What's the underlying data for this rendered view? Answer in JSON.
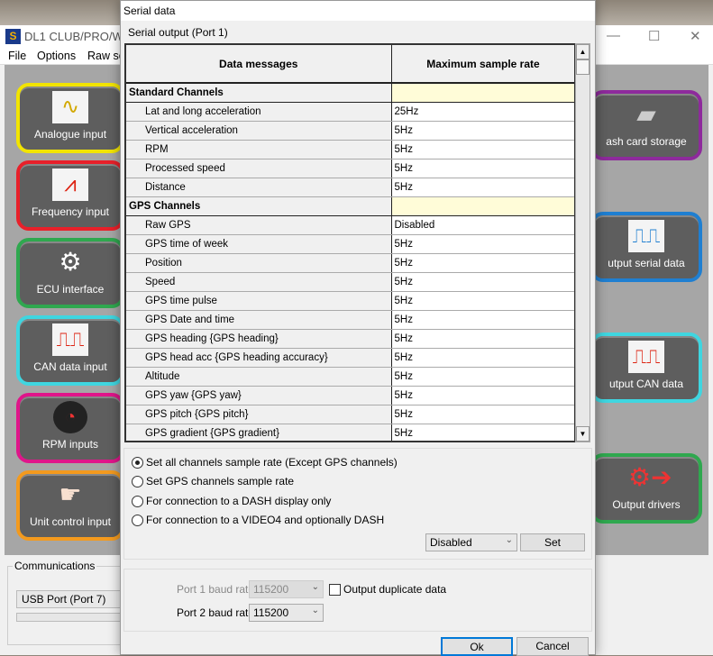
{
  "app": {
    "title": "DL1 CLUB/PRO/WP/",
    "menu": [
      "File",
      "Options",
      "Raw se"
    ],
    "left_tiles": [
      {
        "label": "Analogue input",
        "color": "#f2e400",
        "icon": "sine-wave-icon"
      },
      {
        "label": "Frequency input",
        "color": "#e8202a",
        "icon": "heartbeat-icon"
      },
      {
        "label": "ECU interface",
        "color": "#2fa84f",
        "icon": "engine-icon"
      },
      {
        "label": "CAN data input",
        "color": "#3fd6e0",
        "icon": "square-wave-icon"
      },
      {
        "label": "RPM inputs",
        "color": "#e0158a",
        "icon": "gauge-icon"
      },
      {
        "label": "Unit control input",
        "color": "#f39a1e",
        "icon": "hand-pointer-icon"
      }
    ],
    "right_tiles": [
      {
        "label": "ash card storage",
        "color": "#8e2a9c",
        "icon": "sd-card-icon"
      },
      {
        "label": "utput serial data",
        "color": "#1f7fd1",
        "icon": "square-wave-icon"
      },
      {
        "label": "utput CAN data",
        "color": "#3fd6e0",
        "icon": "square-wave-icon"
      },
      {
        "label": "Output drivers",
        "color": "#2fa84f",
        "icon": "gear-arrow-icon"
      }
    ],
    "communications": {
      "legend": "Communications",
      "port": "USB Port (Port 7)"
    }
  },
  "dialog": {
    "title": "Serial data",
    "port_label": "Serial output (Port 1)",
    "columns": [
      "Data messages",
      "Maximum sample rate"
    ],
    "rows": [
      {
        "section": true,
        "name": "Standard Channels",
        "rate": ""
      },
      {
        "name": "Lat and long acceleration",
        "rate": "25Hz"
      },
      {
        "name": "Vertical acceleration",
        "rate": "5Hz"
      },
      {
        "name": "RPM",
        "rate": "5Hz"
      },
      {
        "name": "Processed speed",
        "rate": "5Hz"
      },
      {
        "name": "Distance",
        "rate": "5Hz"
      },
      {
        "section": true,
        "name": "GPS Channels",
        "rate": ""
      },
      {
        "name": "Raw GPS",
        "rate": "Disabled"
      },
      {
        "name": "GPS time of week",
        "rate": "5Hz"
      },
      {
        "name": "Position",
        "rate": "5Hz"
      },
      {
        "name": "Speed",
        "rate": "5Hz"
      },
      {
        "name": "GPS time pulse",
        "rate": "5Hz"
      },
      {
        "name": "GPS Date and time",
        "rate": "5Hz"
      },
      {
        "name": "GPS heading {GPS heading}",
        "rate": "5Hz"
      },
      {
        "name": "GPS head acc {GPS heading accuracy}",
        "rate": "5Hz"
      },
      {
        "name": "Altitude",
        "rate": "5Hz"
      },
      {
        "name": "GPS yaw {GPS yaw}",
        "rate": "5Hz"
      },
      {
        "name": "GPS pitch {GPS pitch}",
        "rate": "5Hz"
      },
      {
        "name": "GPS gradient {GPS gradient}",
        "rate": "5Hz"
      }
    ],
    "radios": [
      {
        "label": "Set all channels sample rate (Except GPS channels)",
        "checked": true
      },
      {
        "label": "Set GPS channels sample rate",
        "checked": false
      },
      {
        "label": "For connection to a DASH display only",
        "checked": false
      },
      {
        "label": "For connection to a VIDEO4 and optionally DASH",
        "checked": false
      }
    ],
    "rate_select": "Disabled",
    "set_label": "Set",
    "port1_label": "Port 1 baud rate",
    "port1_value": "115200",
    "port2_label": "Port 2 baud rate",
    "port2_value": "115200",
    "duplicate_label": "Output duplicate data",
    "duplicate_checked": false,
    "ok_label": "Ok",
    "cancel_label": "Cancel"
  }
}
